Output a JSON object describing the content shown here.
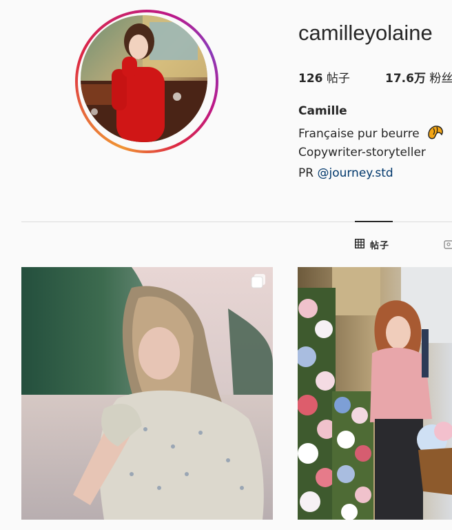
{
  "profile": {
    "username": "camilleyolaine",
    "stats": {
      "posts_count": "126",
      "posts_label": "帖子",
      "followers_count": "17.6万",
      "followers_label": "粉丝"
    },
    "full_name": "Camille",
    "bio": {
      "line1": "Française pur beurre",
      "line1_emoji": "croissant-emoji",
      "line2": "Copywriter-storyteller",
      "line3_prefix": "PR ",
      "line3_mention": "@journey.std"
    }
  },
  "tabs": [
    {
      "label": "帖子",
      "icon": "grid-icon",
      "active": true
    },
    {
      "label": "",
      "icon": "tagged-icon",
      "active": false
    }
  ],
  "posts": [
    {
      "type": "multi-photo",
      "badge_icon": "multiple-photos-icon"
    },
    {
      "type": "photo"
    }
  ],
  "colors": {
    "text": "#262626",
    "mention": "#00376b",
    "divider": "#dbdbdb",
    "background": "#fafafa"
  }
}
